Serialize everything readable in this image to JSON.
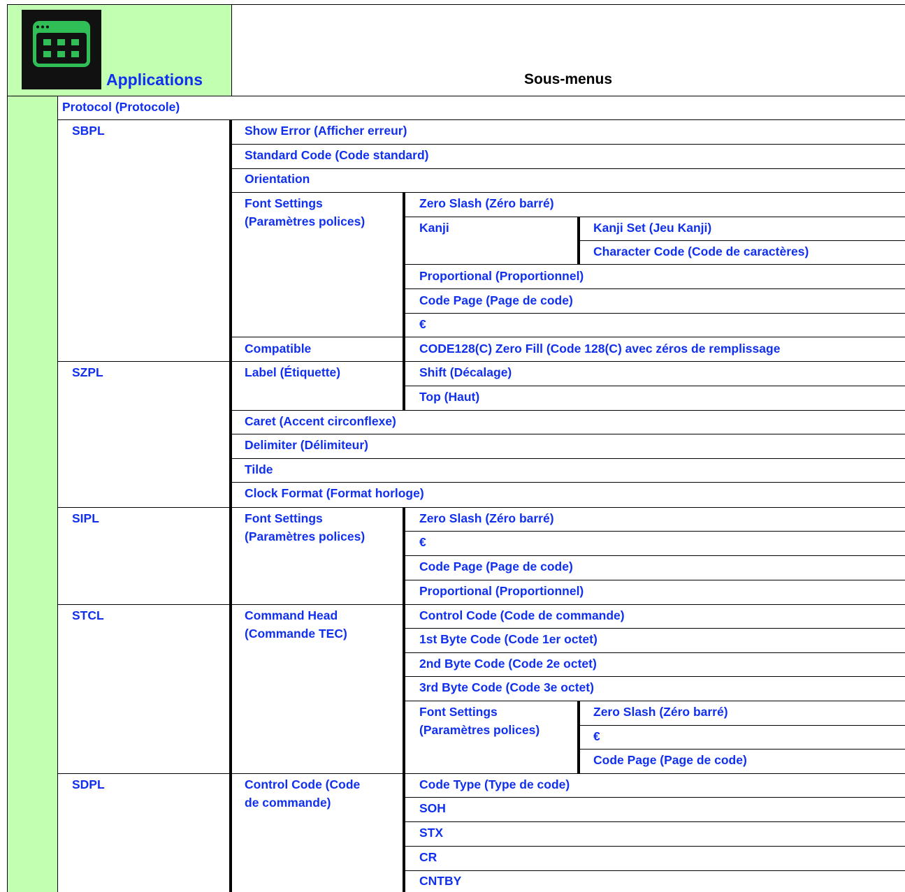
{
  "header": {
    "applications_label": "Applications",
    "submenus_label": "Sous-menus",
    "app_icon": "app-grid-icon"
  },
  "protocol": {
    "label": "Protocol (Protocole)",
    "sbpl": {
      "name": "SBPL",
      "show_error": "Show Error (Afficher erreur)",
      "standard_code": "Standard Code (Code standard)",
      "orientation": "Orientation",
      "font_settings_l1": "Font Settings",
      "font_settings_l2": "(Paramètres polices)",
      "zero_slash": "Zero Slash (Zéro barré)",
      "kanji": "Kanji",
      "kanji_set": "Kanji Set (Jeu Kanji)",
      "character_code": "Character Code (Code de caractères)",
      "proportional": "Proportional (Proportionnel)",
      "code_page": "Code Page (Page de code)",
      "euro": "€",
      "compatible": "Compatible",
      "code128": "CODE128(C) Zero Fill (Code 128(C) avec zéros de remplissage"
    },
    "szpl": {
      "name": "SZPL",
      "label": "Label (Étiquette)",
      "shift": "Shift (Décalage)",
      "top": "Top (Haut)",
      "caret": "Caret (Accent circonflexe)",
      "delimiter": "Delimiter (Délimiteur)",
      "tilde": "Tilde",
      "clock_format": "Clock Format (Format horloge)"
    },
    "sipl": {
      "name": "SIPL",
      "font_settings_l1": "Font Settings",
      "font_settings_l2": "(Paramètres polices)",
      "zero_slash": "Zero Slash (Zéro barré)",
      "euro": "€",
      "code_page": "Code Page (Page de code)",
      "proportional": "Proportional (Proportionnel)"
    },
    "stcl": {
      "name": "STCL",
      "command_head_l1": "Command Head",
      "command_head_l2": "(Commande TEC)",
      "control_code": "Control Code (Code de commande)",
      "byte1": "1st Byte Code (Code 1er octet)",
      "byte2": "2nd Byte Code (Code 2e octet)",
      "byte3": "3rd Byte Code (Code 3e octet)",
      "font_settings_l1": "Font Settings",
      "font_settings_l2": "(Paramètres polices)",
      "zero_slash": "Zero Slash (Zéro barré)",
      "euro": "€",
      "code_page": "Code Page (Page de code)"
    },
    "sdpl": {
      "name": "SDPL",
      "control_code_l1": "Control Code (Code",
      "control_code_l2": "de commande)",
      "code_type": "Code Type (Type de code)",
      "soh": "SOH",
      "stx": "STX",
      "cr": "CR",
      "cntby": "CNTBY"
    }
  }
}
